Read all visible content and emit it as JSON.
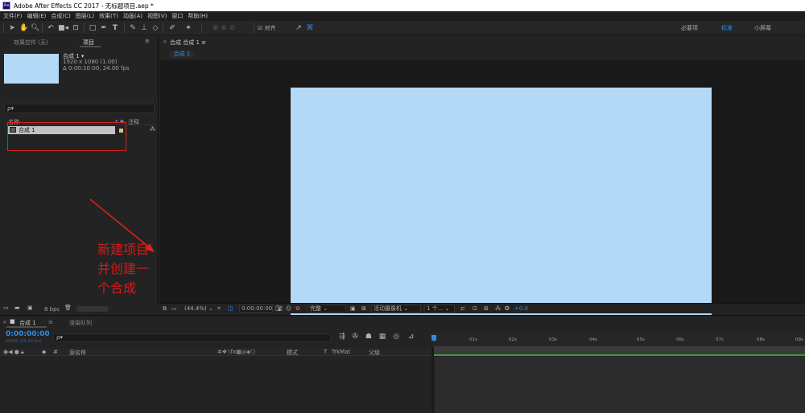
{
  "window": {
    "title": "Adobe After Effects CC 2017 - 无标题项目.aep *",
    "app_icon": "Ae"
  },
  "menu": [
    "文件(F)",
    "编辑(E)",
    "合成(C)",
    "图层(L)",
    "效果(T)",
    "动画(A)",
    "视图(V)",
    "窗口",
    "帮助(H)"
  ],
  "toolbar": {
    "align_label": "对齐",
    "workspaces": {
      "essentials": "必要项",
      "standard": "标准",
      "small_screen": "小屏幕"
    }
  },
  "project_panel": {
    "tab_effects": "效果控件 (无)",
    "tab_project": "项目",
    "comp": {
      "name": "合成 1 ▾",
      "resolution": "1920 x 1080 (1.00)",
      "duration": "Δ 0:00:10:00, 24.00 fps"
    },
    "search_placeholder": "ρ▾",
    "columns": {
      "name": "名称",
      "note": "注释"
    },
    "row": {
      "name": "合成 1"
    },
    "bpc": "8 bpc"
  },
  "annotation": {
    "text": "新建项目并创建一个合成",
    "color": "#d91a1a"
  },
  "viewer": {
    "tab": "合成 合成 1 ≡",
    "sub_tab": "合成 1",
    "canvas_color": "#b3d9f7",
    "zoom": "(44.4%)",
    "timecode": "0:00:00:00",
    "quality": "完整",
    "camera": "活动摄像机",
    "views": "1 个...",
    "exposure": "+0.0"
  },
  "timeline": {
    "tab": "合成 1",
    "render_queue": "渲染队列",
    "current_time": "0:00:00:00",
    "frames": "00000 (24.00 fps)",
    "search_placeholder": "ρ▾",
    "columns": {
      "source_name": "源名称",
      "mode": "模式",
      "t": "T",
      "trkmat": "TrkMat",
      "parent": "父级",
      "hash": "#"
    },
    "ruler": [
      "0s",
      "01s",
      "02s",
      "03s",
      "04s",
      "05s",
      "06s",
      "07s",
      "08s",
      "09s",
      "10s"
    ]
  },
  "colors": {
    "accent": "#2d8ceb",
    "panel": "#232323",
    "highlight": "#e02020"
  }
}
